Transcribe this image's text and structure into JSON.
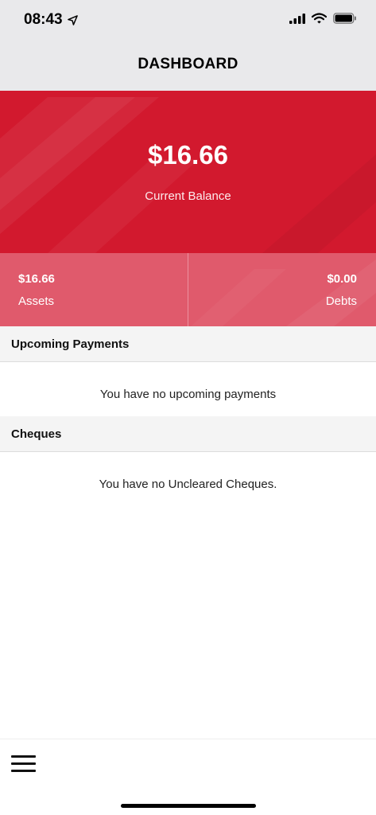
{
  "status_bar": {
    "time": "08:43",
    "location_icon": "location-arrow-icon",
    "signal_icon": "cellular-signal-icon",
    "wifi_icon": "wifi-icon",
    "battery_icon": "battery-icon"
  },
  "header": {
    "title": "DASHBOARD"
  },
  "balance": {
    "amount": "$16.66",
    "label": "Current Balance"
  },
  "summary": {
    "assets_value": "$16.66",
    "assets_label": "Assets",
    "debts_value": "$0.00",
    "debts_label": "Debts"
  },
  "sections": {
    "upcoming": {
      "title": "Upcoming Payments",
      "empty_text": "You have no upcoming payments"
    },
    "cheques": {
      "title": "Cheques",
      "empty_text": "You have no Uncleared Cheques."
    }
  },
  "bottom_bar": {
    "menu_icon": "hamburger-menu-icon"
  },
  "colors": {
    "brand_red": "#d2192e",
    "summary_pink": "#e05a6c",
    "nav_bg": "#e9e9eb",
    "section_bg": "#f4f4f4"
  }
}
